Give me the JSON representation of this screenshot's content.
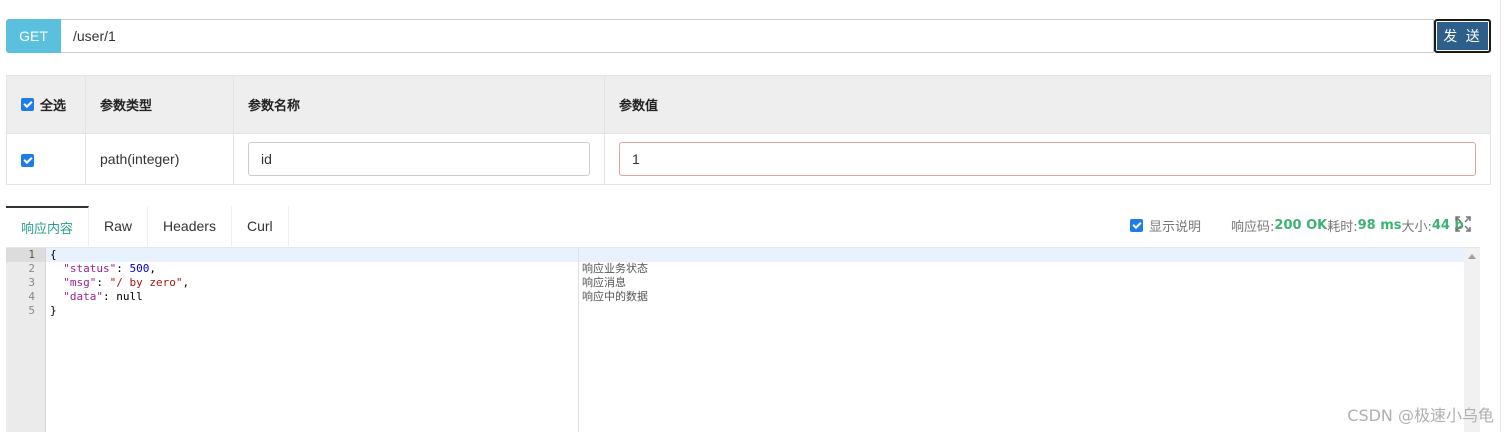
{
  "request": {
    "method": "GET",
    "url": "/user/1",
    "send_label": "发 送"
  },
  "params_table": {
    "headers": {
      "select_all": "全选",
      "param_type": "参数类型",
      "param_name": "参数名称",
      "param_value": "参数值"
    },
    "rows": [
      {
        "checked": true,
        "type": "path(integer)",
        "name": "id",
        "value": "1"
      }
    ]
  },
  "tabs": [
    {
      "label": "响应内容",
      "active": true
    },
    {
      "label": "Raw",
      "active": false
    },
    {
      "label": "Headers",
      "active": false
    },
    {
      "label": "Curl",
      "active": false
    }
  ],
  "response_info": {
    "show_desc_label": "显示说明",
    "show_desc_checked": true,
    "code_label": "响应码:",
    "code_value": "200 OK",
    "time_label": "耗时:",
    "time_value": "98 ms",
    "size_label": "大小:",
    "size_value": "44 b"
  },
  "code": {
    "line_numbers": [
      "1",
      "2",
      "3",
      "4",
      "5"
    ],
    "lines": {
      "l1": "{",
      "l2_key": "\"status\"",
      "l2_val": "500",
      "l3_key": "\"msg\"",
      "l3_val": "\"/ by zero\"",
      "l4_key": "\"data\"",
      "l4_val": "null",
      "l5": "}"
    },
    "descriptions": [
      "响应业务状态",
      "响应消息",
      "响应中的数据"
    ]
  },
  "watermark": "CSDN @极速小乌龟",
  "colors": {
    "method_bg": "#5bc0de",
    "send_bg": "#2e5f8a",
    "accent_green": "#3cb371",
    "active_tab": "#2a9d8f"
  }
}
